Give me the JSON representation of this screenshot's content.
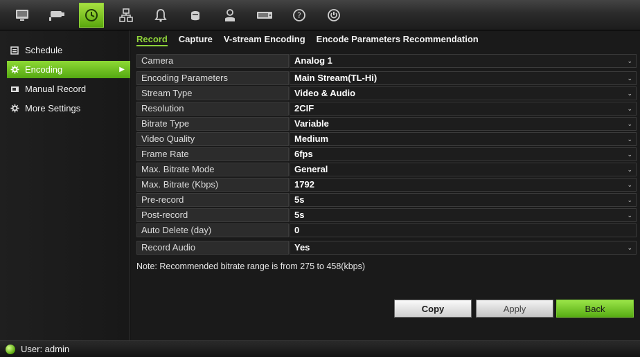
{
  "topbar": {
    "icons": [
      {
        "name": "display-icon"
      },
      {
        "name": "camera-icon"
      },
      {
        "name": "record-clock-icon",
        "active": true
      },
      {
        "name": "network-icon"
      },
      {
        "name": "alarm-bell-icon"
      },
      {
        "name": "device-icon"
      },
      {
        "name": "user-icon"
      },
      {
        "name": "hdd-icon"
      },
      {
        "name": "help-icon"
      },
      {
        "name": "power-icon"
      }
    ],
    "active_color": "#6fc21e"
  },
  "sidebar": {
    "items": [
      {
        "label": "Schedule",
        "icon": "schedule-icon",
        "active": false
      },
      {
        "label": "Encoding",
        "icon": "encoding-gear-icon",
        "active": true
      },
      {
        "label": "Manual Record",
        "icon": "manual-record-icon",
        "active": false
      },
      {
        "label": "More Settings",
        "icon": "settings-gear-icon",
        "active": false
      }
    ]
  },
  "tabs": [
    {
      "label": "Record",
      "active": true
    },
    {
      "label": "Capture",
      "active": false
    },
    {
      "label": "V-stream Encoding",
      "active": false
    },
    {
      "label": "Encode Parameters Recommendation",
      "active": false
    }
  ],
  "form": {
    "rows": [
      {
        "label": "Camera",
        "value": "Analog 1",
        "dropdown": true
      },
      {
        "label": "Encoding Parameters",
        "value": "Main Stream(TL-Hi)",
        "dropdown": true
      },
      {
        "label": "Stream Type",
        "value": "Video & Audio",
        "dropdown": true
      },
      {
        "label": "Resolution",
        "value": "2CIF",
        "dropdown": true
      },
      {
        "label": "Bitrate Type",
        "value": "Variable",
        "dropdown": true
      },
      {
        "label": "Video Quality",
        "value": "Medium",
        "dropdown": true
      },
      {
        "label": "Frame Rate",
        "value": "6fps",
        "dropdown": true
      },
      {
        "label": "Max. Bitrate Mode",
        "value": "General",
        "dropdown": true
      },
      {
        "label": "Max. Bitrate (Kbps)",
        "value": "1792",
        "dropdown": true
      },
      {
        "label": "Pre-record",
        "value": "5s",
        "dropdown": true
      },
      {
        "label": "Post-record",
        "value": "5s",
        "dropdown": true
      },
      {
        "label": "Auto Delete (day)",
        "value": "0",
        "dropdown": false
      },
      {
        "label": "Record Audio",
        "value": "Yes",
        "dropdown": true
      }
    ],
    "note": "Note: Recommended bitrate range is from 275 to 458(kbps)"
  },
  "buttons": {
    "copy": "Copy",
    "apply": "Apply",
    "back": "Back"
  },
  "status": {
    "user": "User: admin"
  }
}
